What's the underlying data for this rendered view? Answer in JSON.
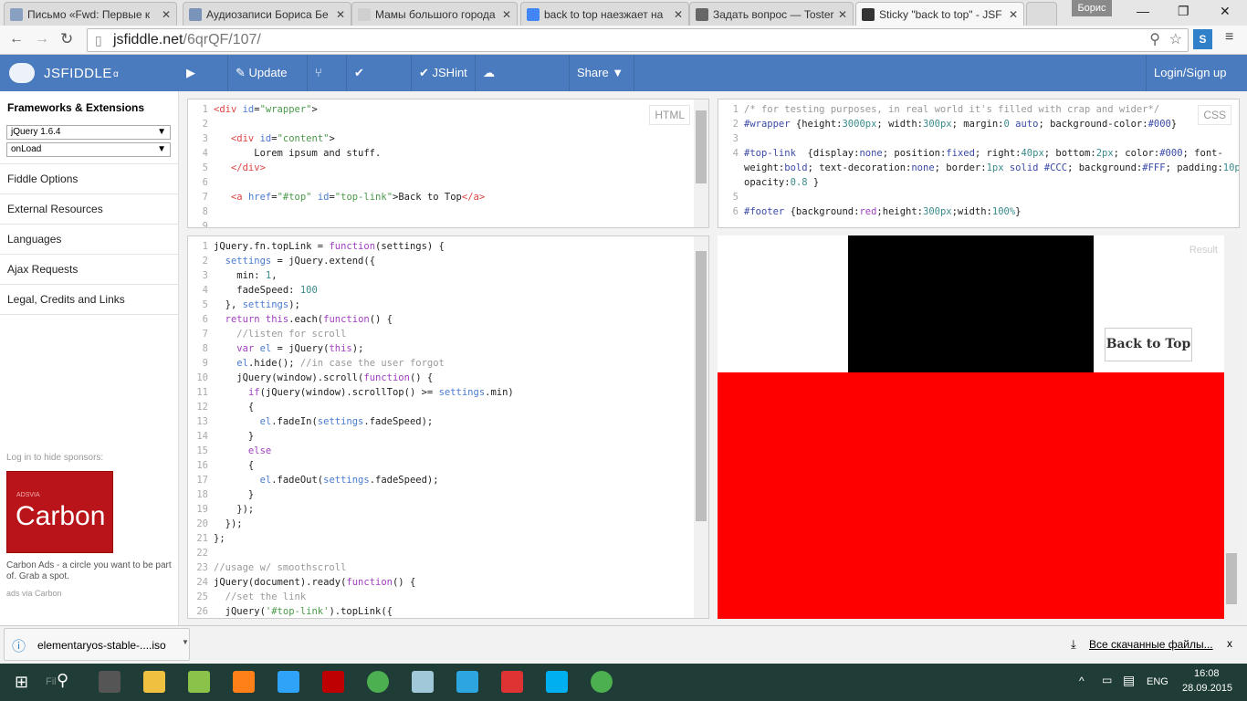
{
  "browser": {
    "tabs": [
      {
        "title": "Письмо «Fwd: Первые к",
        "icon": "mail-icon",
        "color": "#8aa0c0"
      },
      {
        "title": "Аудиозаписи Бориса Бе",
        "icon": "vk-icon",
        "color": "#7a93b8"
      },
      {
        "title": "Мамы большого города",
        "icon": "page-icon",
        "color": "#cfcfcf"
      },
      {
        "title": "back to top наезжает на",
        "icon": "google-icon",
        "color": "#4285f4"
      },
      {
        "title": "Задать вопрос — Toster",
        "icon": "toster-icon",
        "color": "#666"
      },
      {
        "title": "Sticky \"back to top\" - JSF",
        "icon": "jsfiddle-icon",
        "color": "#333"
      }
    ],
    "user": "Борис",
    "url_host": "jsfiddle.net",
    "url_path": "/6qrQF/107/"
  },
  "header": {
    "logo": "JSFIDDLE",
    "logo_sub": "α",
    "buttons": [
      {
        "label": "▶ Run",
        "name": "run-button"
      },
      {
        "label": "✎ Update",
        "name": "update-button"
      },
      {
        "label": "⑂ Fork",
        "name": "fork-button"
      },
      {
        "label": "✔ TidyUp",
        "name": "tidyup-button"
      },
      {
        "label": "✔ JSHint",
        "name": "jshint-button"
      },
      {
        "label": "☁ Collaboration",
        "name": "collaboration-button"
      },
      {
        "label": "Share ▼",
        "name": "share-button"
      }
    ],
    "login": "Login/Sign up 👤"
  },
  "sidebar": {
    "title": "Frameworks & Extensions",
    "framework": "jQuery 1.6.4",
    "load": "onLoad",
    "items": [
      "Fiddle Options",
      "External Resources",
      "Languages",
      "Ajax Requests",
      "Legal, Credits and Links"
    ],
    "sponsor_note": "Log in to hide sponsors:",
    "ad_brand": "Carbon",
    "ad_small": "ADSVIA",
    "ad_text": "Carbon Ads - a circle you want to be part of. Grab a spot.",
    "ad_via": "ads via Carbon"
  },
  "panels": {
    "html_label": "HTML",
    "css_label": "CSS",
    "result_label": "Result",
    "html": [
      [
        [
          "t-tag",
          "<div "
        ],
        [
          "t-attr",
          "id"
        ],
        [
          "",
          "="
        ],
        [
          "t-str",
          "\"wrapper\""
        ],
        [
          "",
          ">"
        ]
      ],
      [],
      [
        [
          "",
          "   "
        ],
        [
          "t-tag",
          "<div "
        ],
        [
          "t-attr",
          "id"
        ],
        [
          "",
          "="
        ],
        [
          "t-str",
          "\"content\""
        ],
        [
          "",
          ">"
        ]
      ],
      [
        [
          "",
          "       Lorem ipsum and stuff."
        ]
      ],
      [
        [
          "",
          "   "
        ],
        [
          "t-tag",
          "</div>"
        ]
      ],
      [],
      [
        [
          "",
          "   "
        ],
        [
          "t-tag",
          "<a "
        ],
        [
          "t-attr",
          "href"
        ],
        [
          "",
          "="
        ],
        [
          "t-str",
          "\"#top\""
        ],
        [
          "t-attr",
          " id"
        ],
        [
          "",
          "="
        ],
        [
          "t-str",
          "\"top-link\""
        ],
        [
          "",
          ">Back to Top"
        ],
        [
          "t-tag",
          "</a>"
        ]
      ],
      [],
      []
    ],
    "css": [
      {
        "n": "1",
        "t": [
          [
            "t-com",
            "/* for testing purposes, in real world it's filled with crap and wider*/"
          ]
        ]
      },
      {
        "n": "2",
        "t": [
          [
            "t-sel",
            "#wrapper"
          ],
          [
            "",
            " {height:"
          ],
          [
            "t-num",
            "3000px"
          ],
          [
            "",
            "; width:"
          ],
          [
            "t-num",
            "300px"
          ],
          [
            "",
            "; margin:"
          ],
          [
            "t-num",
            "0"
          ],
          [
            "t-prop",
            " auto"
          ],
          [
            "",
            "; background-color:"
          ],
          [
            "t-sel",
            "#000"
          ],
          [
            "",
            "}"
          ]
        ]
      },
      {
        "n": "3",
        "t": []
      },
      {
        "n": "4",
        "t": [
          [
            "t-sel",
            "#top-link"
          ],
          [
            "",
            "  {display:"
          ],
          [
            "t-prop",
            "none"
          ],
          [
            "",
            "; position:"
          ],
          [
            "t-prop",
            "fixed"
          ],
          [
            "",
            "; right:"
          ],
          [
            "t-num",
            "40px"
          ],
          [
            "",
            "; bottom:"
          ],
          [
            "t-num",
            "2px"
          ],
          [
            "",
            "; color:"
          ],
          [
            "t-sel",
            "#000"
          ],
          [
            "",
            "; font-"
          ]
        ]
      },
      {
        "n": "",
        "t": [
          [
            "",
            "weight:"
          ],
          [
            "t-prop",
            "bold"
          ],
          [
            "",
            "; text-decoration:"
          ],
          [
            "t-prop",
            "none"
          ],
          [
            "",
            "; border:"
          ],
          [
            "t-num",
            "1px"
          ],
          [
            "t-prop",
            " solid"
          ],
          [
            "t-sel",
            " #CCC"
          ],
          [
            "",
            "; background:"
          ],
          [
            "t-sel",
            "#FFF"
          ],
          [
            "",
            "; padding:"
          ],
          [
            "t-num",
            "10px"
          ],
          [
            "",
            ";"
          ]
        ]
      },
      {
        "n": "",
        "t": [
          [
            "",
            "opacity:"
          ],
          [
            "t-num",
            "0.8"
          ],
          [
            "",
            " }"
          ]
        ]
      },
      {
        "n": "5",
        "t": []
      },
      {
        "n": "6",
        "t": [
          [
            "t-sel",
            "#footer"
          ],
          [
            "",
            " {background:"
          ],
          [
            "t-kw",
            "red"
          ],
          [
            "",
            ";height:"
          ],
          [
            "t-num",
            "300px"
          ],
          [
            "",
            ";width:"
          ],
          [
            "t-num",
            "100%"
          ],
          [
            "",
            "}"
          ]
        ]
      }
    ],
    "js": [
      [
        [
          "",
          "jQuery.fn.topLink = "
        ],
        [
          "t-kw",
          "function"
        ],
        [
          "",
          "(settings) {"
        ]
      ],
      [
        [
          "",
          "  "
        ],
        [
          "t-attr",
          "settings"
        ],
        [
          "",
          " = jQuery.extend({"
        ]
      ],
      [
        [
          "",
          "    min: "
        ],
        [
          "t-num",
          "1"
        ],
        [
          "",
          ","
        ]
      ],
      [
        [
          "",
          "    fadeSpeed: "
        ],
        [
          "t-num",
          "100"
        ]
      ],
      [
        [
          "",
          "  }, "
        ],
        [
          "t-attr",
          "settings"
        ],
        [
          "",
          ");"
        ]
      ],
      [
        [
          "",
          "  "
        ],
        [
          "t-kw",
          "return this"
        ],
        [
          "",
          ".each("
        ],
        [
          "t-kw",
          "function"
        ],
        [
          "",
          "() {"
        ]
      ],
      [
        [
          "t-com",
          "    //listen for scroll"
        ]
      ],
      [
        [
          "",
          "    "
        ],
        [
          "t-kw",
          "var"
        ],
        [
          "t-attr",
          " el"
        ],
        [
          "",
          " = jQuery("
        ],
        [
          "t-kw",
          "this"
        ],
        [
          "",
          ");"
        ]
      ],
      [
        [
          "t-attr",
          "    el"
        ],
        [
          "",
          ".hide(); "
        ],
        [
          "t-com",
          "//in case the user forgot"
        ]
      ],
      [
        [
          "",
          "    jQuery(window).scroll("
        ],
        [
          "t-kw",
          "function"
        ],
        [
          "",
          "() {"
        ]
      ],
      [
        [
          "",
          "      "
        ],
        [
          "t-kw",
          "if"
        ],
        [
          "",
          "(jQuery(window).scrollTop() >= "
        ],
        [
          "t-attr",
          "settings"
        ],
        [
          "",
          ".min)"
        ]
      ],
      [
        [
          "",
          "      {"
        ]
      ],
      [
        [
          "t-attr",
          "        el"
        ],
        [
          "",
          ".fadeIn("
        ],
        [
          "t-attr",
          "settings"
        ],
        [
          "",
          ".fadeSpeed);"
        ]
      ],
      [
        [
          "",
          "      }"
        ]
      ],
      [
        [
          "t-kw",
          "      else"
        ]
      ],
      [
        [
          "",
          "      {"
        ]
      ],
      [
        [
          "t-attr",
          "        el"
        ],
        [
          "",
          ".fadeOut("
        ],
        [
          "t-attr",
          "settings"
        ],
        [
          "",
          ".fadeSpeed);"
        ]
      ],
      [
        [
          "",
          "      }"
        ]
      ],
      [
        [
          "",
          "    });"
        ]
      ],
      [
        [
          "",
          "  });"
        ]
      ],
      [
        [
          "",
          "};"
        ]
      ],
      [],
      [
        [
          "t-com",
          "//usage w/ smoothscroll"
        ]
      ],
      [
        [
          "",
          "jQuery(document).ready("
        ],
        [
          "t-kw",
          "function"
        ],
        [
          "",
          "() {"
        ]
      ],
      [
        [
          "t-com",
          "  //set the link"
        ]
      ],
      [
        [
          "",
          "  jQuery("
        ],
        [
          "t-str",
          "'#top-link'"
        ],
        [
          "",
          ").topLink({"
        ]
      ]
    ],
    "result_button": "Back to Top"
  },
  "downloads": {
    "file": "elementaryos-stable-....iso",
    "all": "Все скачанные файлы...",
    "close": "x"
  },
  "taskbar": {
    "search_ghost": "Fil",
    "lang": "ENG",
    "time": "16:08",
    "date": "28.09.2015",
    "apps": [
      {
        "name": "sublime-icon",
        "color": "#555"
      },
      {
        "name": "file-explorer-icon",
        "color": "#f0c040"
      },
      {
        "name": "notepad-icon",
        "color": "#8bc34a"
      },
      {
        "name": "illustrator-icon",
        "color": "#ff7f18"
      },
      {
        "name": "photoshop-icon",
        "color": "#2fa3f7"
      },
      {
        "name": "filezilla-icon",
        "color": "#bf0000"
      },
      {
        "name": "chrome-icon",
        "color": "#4caf50"
      },
      {
        "name": "notes-icon",
        "color": "#a0c8d8"
      },
      {
        "name": "telegram-icon",
        "color": "#2ca5e0"
      },
      {
        "name": "app-red-icon",
        "color": "#d33"
      },
      {
        "name": "skype-icon",
        "color": "#00aff0"
      },
      {
        "name": "chrome-icon",
        "color": "#4caf50"
      }
    ]
  },
  "colors": {
    "header": "#4a7bbf",
    "result_block": "#000000",
    "result_footer": "#ff0000",
    "taskbar": "#1f3d36"
  }
}
